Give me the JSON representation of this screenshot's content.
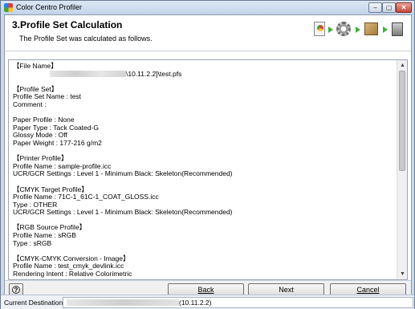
{
  "window": {
    "title": "Color Centro Profiler",
    "min_glyph": "–",
    "max_glyph": "▢",
    "close_glyph": "✕"
  },
  "header": {
    "step_title": "3.Profile Set Calculation",
    "step_subtitle": "The Profile Set was calculated as follows."
  },
  "content": {
    "lines": [
      "【File Name】",
      "__BLUR__\\10.11.2.2]\\test.pfs",
      "",
      "【Profile Set】",
      "Profile Set Name : test",
      "Comment :",
      "",
      "Paper Profile : None",
      "Paper Type : Tack Coated-G",
      "Glossy Mode : Off",
      "Paper Weight : 177-216 g/m2",
      "",
      "【Printer Profile】",
      "Profile Name : sample-profile.icc",
      "UCR/GCR Settings : Level 1 - Minimum Black: Skeleton(Recommended)",
      "",
      "【CMYK Target Profile】",
      "Profile Name : 71C-1_61C-1_COAT_GLOSS.icc",
      "Type : OTHER",
      "UCR/GCR Settings : Level 1 - Minimum Black: Skeleton(Recommended)",
      "",
      "【RGB Source Profile】",
      "Profile Name : sRGB",
      "Type : sRGB",
      "",
      "【CMYK-CMYK Conversion - Image】",
      "Profile Name : test_cmyk_devlink.icc",
      "Rendering Intent : Relative Colorimetric"
    ]
  },
  "buttons": {
    "help": "?",
    "back": "Back",
    "next": "Next",
    "cancel": "Cancel"
  },
  "status": {
    "label": "Current Destination",
    "value": "(10.11.2.2)"
  },
  "scrollbar": {
    "up_glyph": "▲",
    "down_glyph": "▼"
  }
}
